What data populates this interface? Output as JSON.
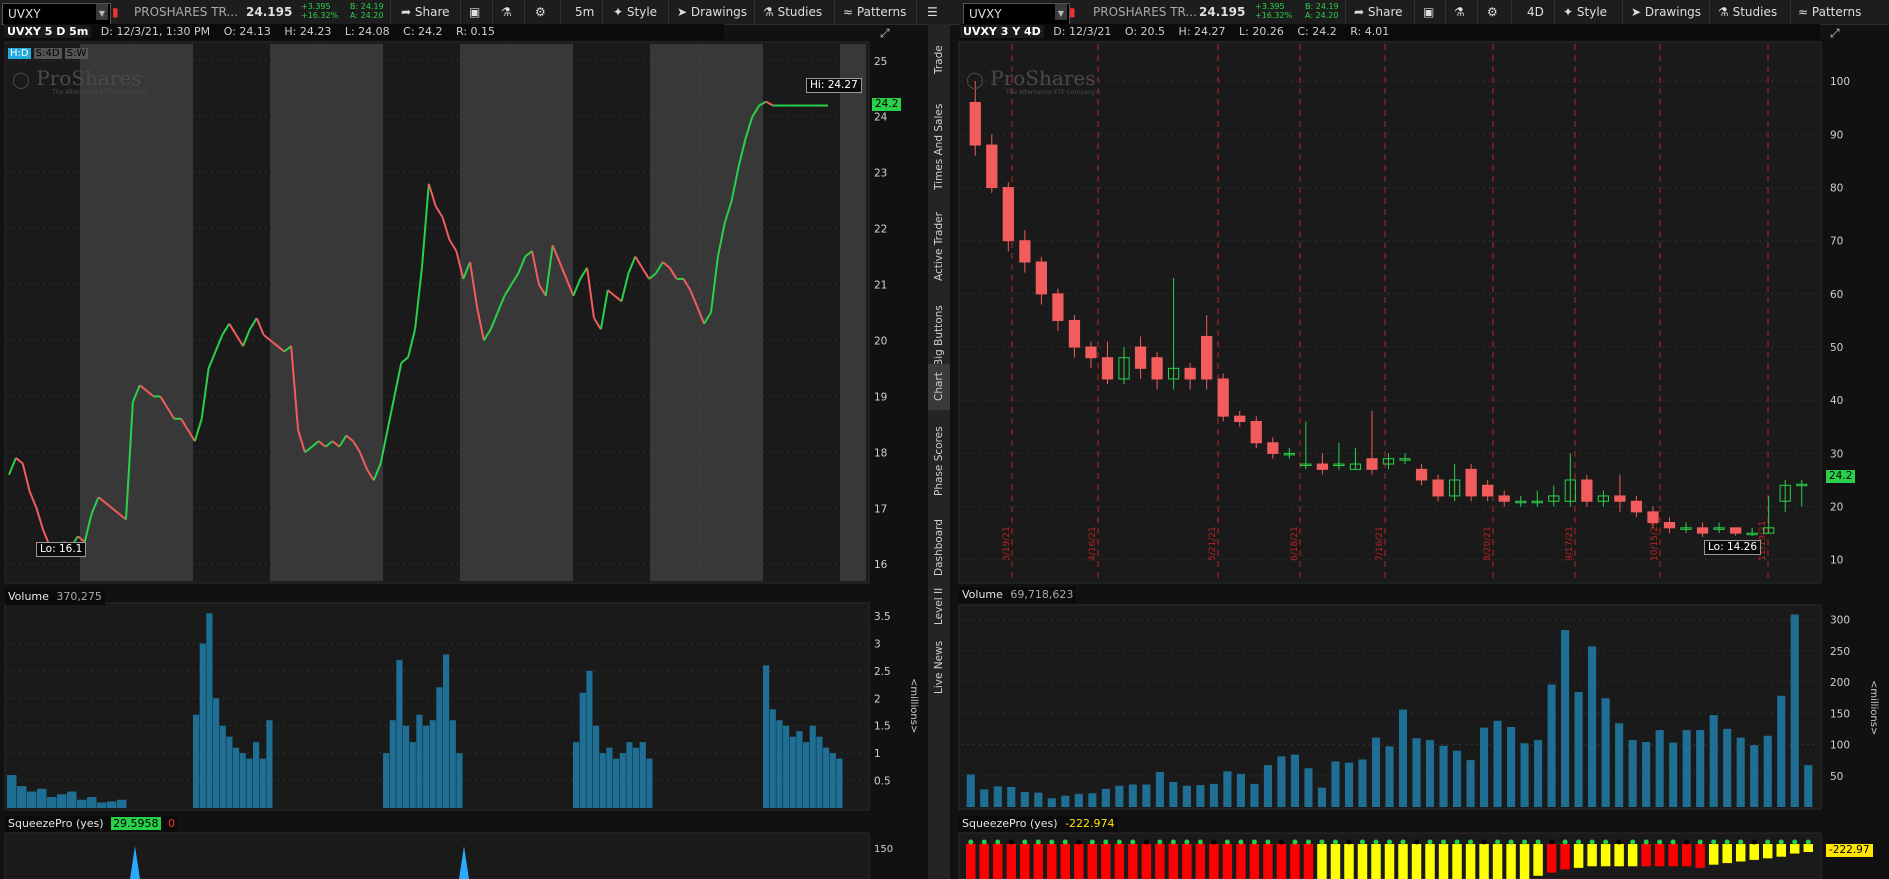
{
  "left": {
    "symbol": "UVXY",
    "company": "PROSHARES TR...",
    "price": "24.195",
    "change_abs": "+3.395",
    "change_pct": "+16.32%",
    "bid": "B: 24.19",
    "ask": "A: 24.20",
    "toolbar": {
      "share": "Share",
      "interval": "5m",
      "style": "Style",
      "drawings": "Drawings",
      "studies": "Studies",
      "patterns": "Patterns"
    },
    "header": {
      "label": "UVXY 5 D 5m",
      "date": "D: 12/3/21, 1:30 PM",
      "open": "O: 24.13",
      "high": "H: 24.23",
      "low": "L: 24.08",
      "close": "C: 24.2",
      "range": "R: 0.15"
    },
    "modes": [
      "H:D",
      "S:4D",
      "S:W"
    ],
    "watermark": "ProShares",
    "watermark_sub": "The Alternative ETF Company®",
    "hi_label": "Hi: 24.27",
    "lo_label": "Lo: 16.1",
    "last_tag": "24.2",
    "volume_label": "Volume",
    "volume_value": "370,275",
    "volume_units": "<millions>",
    "squeeze_label": "SqueezePro (yes)",
    "squeeze_value": "29.5958",
    "squeeze_value2": "0",
    "squeeze_tick": "150"
  },
  "right": {
    "symbol": "UVXY",
    "company": "PROSHARES TR...",
    "price": "24.195",
    "change_abs": "+3.395",
    "change_pct": "+16.32%",
    "bid": "B: 24.19",
    "ask": "A: 24.20",
    "toolbar": {
      "share": "Share",
      "interval": "4D",
      "style": "Style",
      "drawings": "Drawings",
      "studies": "Studies",
      "patterns": "Patterns"
    },
    "header": {
      "label": "UVXY 3 Y 4D",
      "date": "D: 12/3/21",
      "open": "O: 20.5",
      "high": "H: 24.27",
      "low": "L: 20.26",
      "close": "C: 24.2",
      "range": "R: 4.01"
    },
    "watermark": "ProShares",
    "watermark_sub": "The Alternative ETF Company®",
    "lo_label": "Lo: 14.26",
    "last_tag": "24.2",
    "volume_label": "Volume",
    "volume_value": "69,718,623",
    "volume_units": "<millions>",
    "squeeze_label": "SqueezePro (yes)",
    "squeeze_value": "-222.974",
    "squeeze_tag": "-222.97"
  },
  "side_tabs": [
    "Trade",
    "Times And Sales",
    "Active Trader",
    "Big Buttons",
    "Chart",
    "Phase Scores",
    "Dashboard",
    "Level II",
    "Live News"
  ],
  "colors": {
    "up": "#2bd04a",
    "down": "#f25c5c",
    "volume": "#1f6f95",
    "background": "#1a1a1a",
    "band": "#383838",
    "squeeze_red": "#ff0000",
    "squeeze_yellow": "#ffff00",
    "squeeze_dot": "#2bd04a"
  },
  "chart_data": [
    {
      "type": "line",
      "name": "UVXY 5 D 5m",
      "ylim": [
        15.7,
        25.3
      ],
      "yticks": [
        16,
        17,
        18,
        19,
        20,
        21,
        22,
        23,
        24,
        25
      ],
      "sessions": 5,
      "x": [
        0,
        1,
        2,
        3,
        4,
        5,
        6,
        7,
        8,
        9,
        10,
        11,
        12,
        13,
        14,
        15,
        16,
        17,
        18,
        19,
        20,
        21,
        22,
        23,
        24,
        25,
        26,
        27,
        28,
        29,
        30,
        31,
        32,
        33,
        34,
        35,
        36,
        37,
        38,
        39,
        40,
        41,
        42,
        43,
        44,
        45,
        46,
        47,
        48,
        49,
        50,
        51,
        52,
        53,
        54,
        55,
        56,
        57,
        58,
        59,
        60,
        61,
        62,
        63,
        64,
        65,
        66,
        67,
        68,
        69,
        70,
        71,
        72,
        73,
        74,
        75,
        76,
        77,
        78,
        79,
        80,
        81,
        82,
        83,
        84,
        85,
        86,
        87,
        88,
        89,
        90,
        91,
        92,
        93,
        94,
        95,
        96,
        97,
        98,
        99,
        100,
        101,
        102,
        103,
        104,
        105,
        106,
        107,
        108,
        109,
        110,
        111,
        112,
        113,
        114,
        115,
        116,
        117,
        118,
        119
      ],
      "values": [
        17.6,
        17.9,
        17.8,
        17.3,
        17.0,
        16.6,
        16.3,
        16.2,
        16.4,
        16.3,
        16.5,
        16.4,
        16.9,
        17.2,
        17.1,
        17.0,
        16.9,
        16.8,
        18.9,
        19.2,
        19.1,
        19.0,
        19.0,
        18.8,
        18.6,
        18.6,
        18.4,
        18.2,
        18.6,
        19.5,
        19.8,
        20.1,
        20.3,
        20.1,
        19.9,
        20.2,
        20.4,
        20.1,
        20.0,
        19.9,
        19.8,
        19.9,
        18.4,
        18.0,
        18.1,
        18.2,
        18.1,
        18.2,
        18.1,
        18.3,
        18.2,
        18.0,
        17.7,
        17.5,
        17.8,
        18.4,
        19.0,
        19.6,
        19.7,
        20.2,
        21.3,
        22.8,
        22.4,
        22.2,
        21.8,
        21.6,
        21.1,
        21.4,
        20.6,
        20.0,
        20.2,
        20.5,
        20.8,
        21.0,
        21.2,
        21.5,
        21.6,
        21.0,
        20.8,
        21.7,
        21.4,
        21.1,
        20.8,
        21.1,
        21.3,
        20.4,
        20.2,
        20.9,
        20.8,
        20.7,
        21.2,
        21.5,
        21.3,
        21.1,
        21.2,
        21.4,
        21.3,
        21.1,
        21.1,
        20.9,
        20.6,
        20.3,
        20.5,
        21.5,
        22.1,
        22.5,
        23.1,
        23.6,
        24.0,
        24.2,
        24.27,
        24.2,
        24.2,
        24.2,
        24.2,
        24.2,
        24.2,
        24.2,
        24.2,
        24.2
      ]
    },
    {
      "type": "candlestick",
      "name": "UVXY 3 Y 4D",
      "ylim": [
        6,
        107
      ],
      "yticks": [
        10,
        20,
        30,
        40,
        50,
        60,
        70,
        80,
        90,
        100
      ],
      "date_markers": [
        "3/19/21",
        "4/16/21",
        "5/21/21",
        "6/18/21",
        "7/16/21",
        "8/20/21",
        "9/17/21",
        "10/15/21",
        "11/19/21"
      ],
      "open": [
        96,
        88,
        80,
        70,
        66,
        60,
        55,
        50,
        48,
        44,
        50,
        48,
        44,
        46,
        52,
        44,
        37,
        36,
        32,
        30,
        28,
        28,
        28,
        27,
        29,
        28,
        29,
        27,
        25,
        22,
        27,
        24,
        22,
        21,
        21,
        21,
        21,
        25,
        21,
        22,
        21,
        19,
        17,
        16,
        16,
        16,
        16,
        15,
        15,
        21,
        24
      ],
      "close": [
        88,
        80,
        70,
        66,
        60,
        55,
        50,
        48,
        44,
        48,
        46,
        44,
        46,
        44,
        44,
        37,
        36,
        32,
        30,
        30,
        28,
        27,
        28,
        28,
        27,
        29,
        29,
        25,
        22,
        25,
        22,
        22,
        21,
        21,
        21,
        22,
        25,
        21,
        22,
        21,
        19,
        17,
        16,
        16,
        15,
        16,
        15,
        15,
        16,
        24,
        24.2
      ],
      "high": [
        100,
        90,
        81,
        72,
        67,
        61,
        56,
        51,
        51,
        50,
        52,
        49,
        63,
        47,
        56,
        45,
        38,
        37,
        33,
        31,
        36,
        30,
        32,
        31,
        38,
        30,
        30,
        28,
        26,
        28,
        28,
        25,
        23,
        22,
        23,
        24,
        30,
        26,
        23,
        26,
        22,
        20,
        18,
        17,
        17,
        17,
        16,
        16,
        22,
        25,
        25
      ],
      "low": [
        86,
        79,
        68,
        64,
        58,
        53,
        48,
        46,
        43,
        43,
        44,
        42,
        42,
        42,
        42,
        36,
        35,
        31,
        29,
        29,
        27,
        26,
        27,
        27,
        26,
        27,
        28,
        24,
        21,
        21,
        21,
        21,
        20,
        20,
        20,
        20,
        20,
        20,
        20,
        19,
        18,
        16,
        15,
        15,
        14.26,
        15,
        14.5,
        14.5,
        15,
        19,
        20
      ]
    },
    {
      "type": "bar",
      "name": "Volume 5 D (millions)",
      "ylim": [
        0,
        3.7
      ],
      "yticks": [
        0.5,
        1,
        1.5,
        2,
        2.5,
        3,
        3.5
      ],
      "sessions": [
        {
          "peaks": [
            0.6,
            0.4,
            0.3,
            0.35,
            0.2,
            0.25,
            0.3,
            0.15,
            0.2,
            0.1,
            0.12,
            0.15
          ]
        },
        {
          "peaks": [
            1.7,
            3.0,
            3.55,
            2.0,
            1.5,
            1.3,
            1.1,
            1.0,
            0.9,
            1.2,
            0.9,
            1.6
          ]
        },
        {
          "peaks": [
            1.0,
            1.6,
            2.7,
            1.5,
            1.2,
            1.7,
            1.5,
            1.6,
            2.2,
            2.8,
            1.6,
            1.0
          ]
        },
        {
          "peaks": [
            1.2,
            2.1,
            2.5,
            1.5,
            1.0,
            1.1,
            0.9,
            1.0,
            1.2,
            1.1,
            1.2,
            0.9
          ]
        },
        {
          "peaks": [
            2.6,
            1.8,
            1.6,
            1.5,
            1.3,
            1.4,
            1.2,
            1.5,
            1.3,
            1.1,
            1.0,
            0.9
          ]
        }
      ]
    },
    {
      "type": "bar",
      "name": "Volume 3 Y 4D (millions)",
      "ylim": [
        0,
        320
      ],
      "yticks": [
        50,
        100,
        150,
        200,
        250,
        300
      ],
      "values": [
        52,
        28,
        33,
        32,
        24,
        23,
        14,
        18,
        21,
        22,
        29,
        34,
        36,
        36,
        56,
        40,
        34,
        35,
        37,
        57,
        53,
        37,
        67,
        81,
        84,
        62,
        31,
        73,
        71,
        76,
        111,
        97,
        156,
        110,
        107,
        98,
        90,
        75,
        127,
        138,
        128,
        102,
        107,
        196,
        283,
        184,
        257,
        174,
        134,
        107,
        104,
        123,
        103,
        123,
        123,
        147,
        125,
        111,
        99,
        114,
        178,
        308,
        67
      ]
    },
    {
      "type": "bar",
      "name": "SqueezePro 3 Y 4D",
      "values": [
        -220,
        -220,
        -220,
        -220,
        -220,
        -220,
        -220,
        -220,
        -220,
        -220,
        -220,
        -220,
        -220,
        -220,
        -220,
        -220,
        -220,
        -220,
        -220,
        -220,
        -220,
        -220,
        -220,
        -220,
        -220,
        -220,
        -220,
        -220,
        -220,
        -220,
        -220,
        -220,
        -220,
        -220,
        -220,
        -220,
        -220,
        -220,
        -220,
        -220,
        -220,
        -220,
        -200,
        -180,
        -160,
        -150,
        -140,
        -140,
        -140,
        -140,
        -140,
        -140,
        -140,
        -140,
        -150,
        -130,
        -120,
        -110,
        -100,
        -90,
        -80,
        -60,
        -50
      ],
      "colors": [
        "red",
        "red",
        "red",
        "red",
        "red",
        "red",
        "red",
        "red",
        "red",
        "red",
        "red",
        "red",
        "red",
        "red",
        "red",
        "red",
        "red",
        "red",
        "red",
        "red",
        "red",
        "red",
        "red",
        "red",
        "red",
        "red",
        "yellow",
        "yellow",
        "yellow",
        "yellow",
        "yellow",
        "yellow",
        "yellow",
        "yellow",
        "yellow",
        "yellow",
        "yellow",
        "yellow",
        "yellow",
        "yellow",
        "yellow",
        "yellow",
        "yellow",
        "red",
        "red",
        "yellow",
        "yellow",
        "yellow",
        "yellow",
        "yellow",
        "red",
        "red",
        "red",
        "red",
        "red",
        "yellow",
        "yellow",
        "yellow",
        "yellow",
        "yellow",
        "yellow",
        "yellow",
        "yellow"
      ]
    }
  ]
}
